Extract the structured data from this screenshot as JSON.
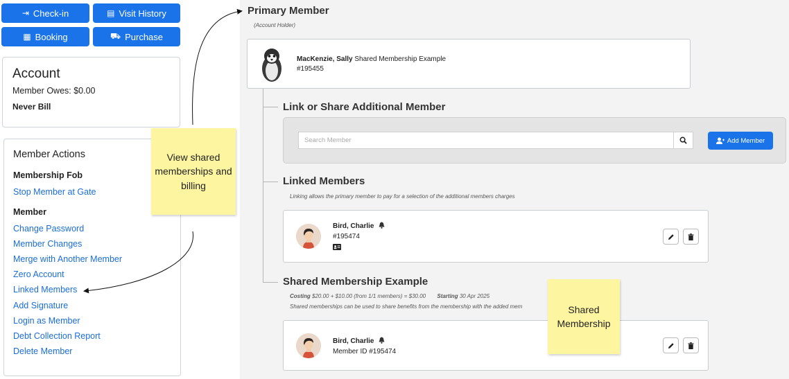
{
  "top_buttons": {
    "checkin": "Check-in",
    "visit_history": "Visit History",
    "booking": "Booking",
    "purchase": "Purchase"
  },
  "account": {
    "title": "Account",
    "owes": "Member Owes: $0.00",
    "billing": "Never Bill"
  },
  "member_actions": {
    "title": "Member Actions",
    "fob_heading": "Membership Fob",
    "fob_links": [
      "Stop Member at Gate"
    ],
    "member_heading": "Member",
    "member_links": [
      "Change Password",
      "Member Changes",
      "Merge with Another Member",
      "Zero Account",
      "Linked Members",
      "Add Signature",
      "Login as Member",
      "Debt Collection Report",
      "Delete Member"
    ]
  },
  "primary": {
    "heading": "Primary Member",
    "sub": "(Account Holder)",
    "name_bold": "MacKenzie, Sally",
    "name_rest": " Shared Membership Example",
    "number": "#195455"
  },
  "link_share": {
    "heading": "Link or Share Additional Member",
    "search_placeholder": "Search Member",
    "add_member_label": "Add Member"
  },
  "linked_members": {
    "heading": "Linked Members",
    "description": "Linking allows the primary member to pay for a selection of the additional members charges",
    "member_name": "Bird, Charlie",
    "member_number": "#195474"
  },
  "shared_membership": {
    "heading": "Shared Membership Example",
    "costing_label": "Costing",
    "costing_value": "$20.00 + $10.00 (from 1/1 members) = $30.00",
    "starting_label": "Starting",
    "starting_value": "30 Apr 2025",
    "description": "Shared memberships can be used to share benefits from the membership with the added mem",
    "member_name": "Bird, Charlie",
    "member_id": "Member ID #195474"
  },
  "sticky_notes": {
    "view_shared": "View shared memberships and billing",
    "shared": "Shared Membership"
  },
  "colors": {
    "primary_blue": "#1a73e8",
    "link_blue": "#1a6dd6",
    "panel_bg": "#f3f3f3",
    "sticky_yellow": "#fdf5a0"
  }
}
